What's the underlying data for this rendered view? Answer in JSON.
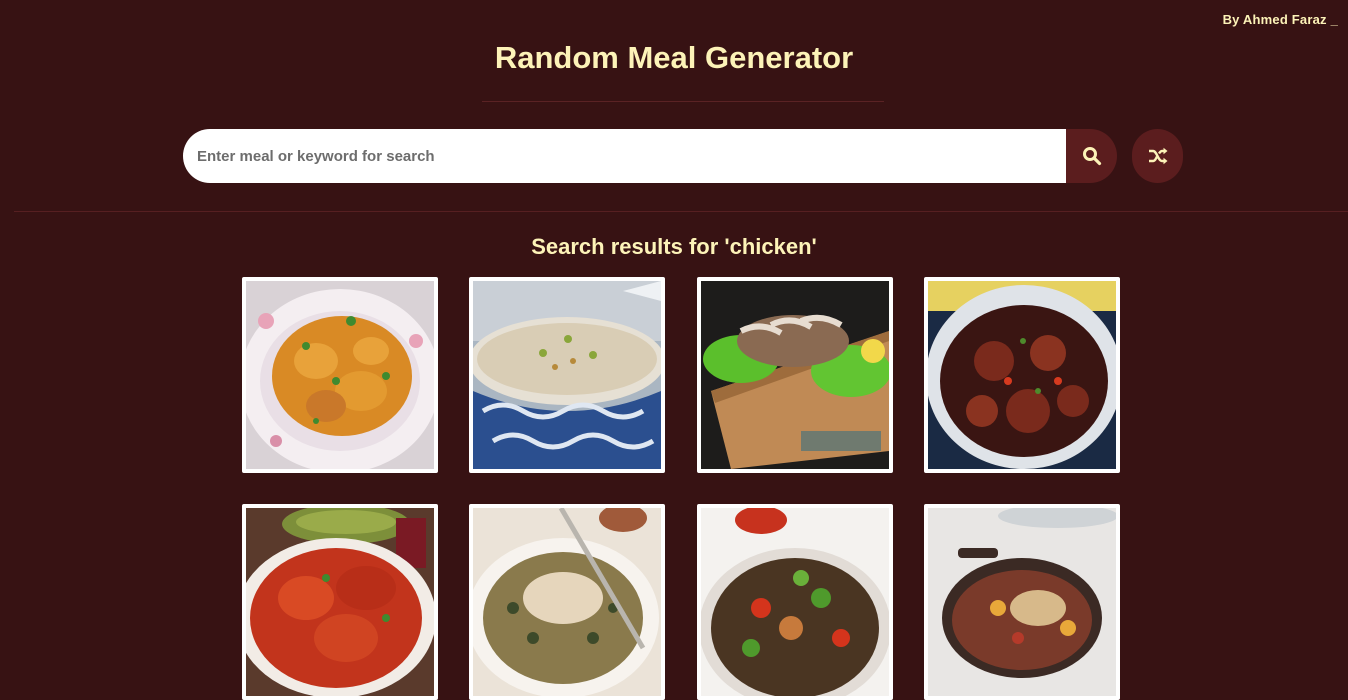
{
  "header": {
    "author": "By Ahmed Faraz _",
    "title": "Random Meal Generator"
  },
  "search": {
    "placeholder": "Enter meal or keyword for search",
    "value": "",
    "search_icon": "search-icon",
    "random_icon": "shuffle-icon"
  },
  "results": {
    "heading": "Search results for 'chicken'"
  },
  "meals": [
    {
      "icon": "meal-image"
    },
    {
      "icon": "meal-image"
    },
    {
      "icon": "meal-image"
    },
    {
      "icon": "meal-image"
    },
    {
      "icon": "meal-image"
    },
    {
      "icon": "meal-image"
    },
    {
      "icon": "meal-image"
    },
    {
      "icon": "meal-image"
    }
  ],
  "colors": {
    "background": "#371213",
    "accent": "#fdf3b8",
    "button": "#5b1d1e"
  }
}
